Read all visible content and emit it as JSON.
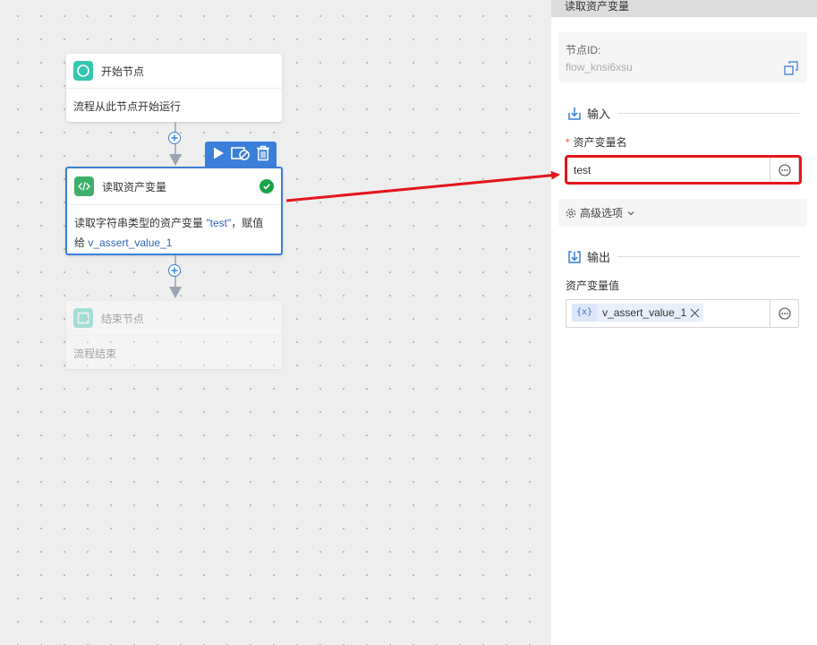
{
  "canvas": {
    "nodes": {
      "start": {
        "title": "开始节点",
        "desc": "流程从此节点开始运行"
      },
      "read": {
        "title": "读取资产变量",
        "desc_prefix": "读取字符串类型的资产变量 ",
        "desc_var": "\"test\"",
        "desc_mid": "，赋值给 ",
        "desc_target": "v_assert_value_1"
      },
      "end": {
        "title": "结束节点",
        "desc": "流程结束"
      }
    }
  },
  "panel": {
    "title": "读取资产变量",
    "node_id_label": "节点ID:",
    "node_id_value": "flow_knsi6xsu",
    "input_section": "输入",
    "asset_name_label": "资产变量名",
    "asset_name_value": "test",
    "advanced_label": "高级选项",
    "output_section": "输出",
    "asset_value_label": "资产变量值",
    "output_tag_badge": "{x}",
    "output_tag_value": "v_assert_value_1"
  },
  "colors": {
    "accent": "#3a7fd9",
    "start_icon": "#35c7b3",
    "read_icon": "#3fb06c",
    "success": "#1aa34a",
    "annotation": "#e5151a"
  }
}
